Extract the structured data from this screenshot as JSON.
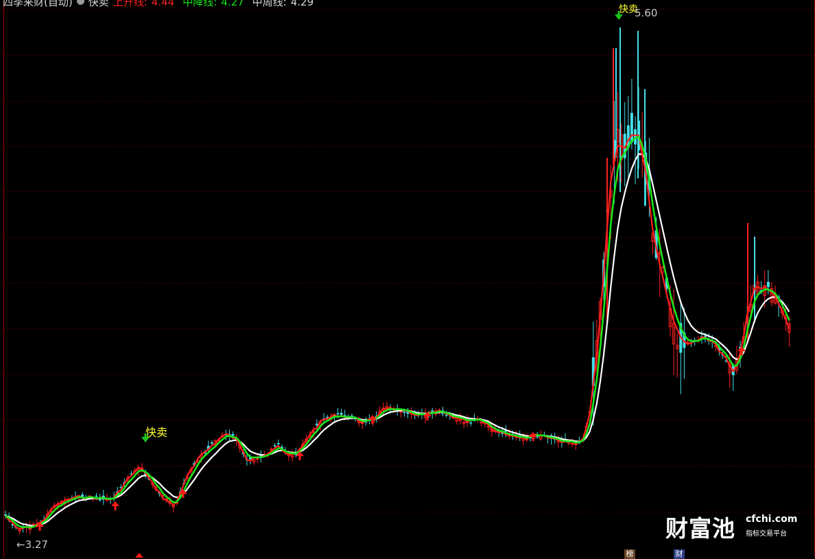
{
  "header": {
    "indicator_name": "四季来财(自动)",
    "signal_name": "快卖",
    "up_label": "上升线:",
    "up_value": "4.44",
    "mid_label": "中降线:",
    "mid_value": "4.27",
    "long_label": "中周线:",
    "long_value": "4.29"
  },
  "signals": {
    "sell_label_1": "快卖",
    "sell_label_2": "快卖"
  },
  "price_labels": {
    "high": "5.60",
    "low": "3.27",
    "low_arrow": "←"
  },
  "bottom_tags": {
    "tag1": "榜",
    "tag2": "财"
  },
  "watermark": {
    "cn": "财富池",
    "domain": "cfchi.com",
    "sub": "指标交易平台"
  },
  "colors": {
    "background": "#000000",
    "candle_up": "#ff2020",
    "candle_down": "#44e0e8",
    "line_fast": "#ff2020",
    "line_mid": "#19e619",
    "line_slow": "#ffffff",
    "grid": "#7a0000",
    "sell_label": "#ffff33",
    "buy_marker": "#ff1a1a",
    "sell_marker": "#19c419"
  },
  "chart_data": {
    "type": "candlestick",
    "y_axis": {
      "low": 3.27,
      "high": 5.6
    },
    "series": [
      {
        "name": "上升线",
        "last": 4.44
      },
      {
        "name": "中降线",
        "last": 4.27
      },
      {
        "name": "中周线",
        "last": 4.29
      }
    ]
  }
}
